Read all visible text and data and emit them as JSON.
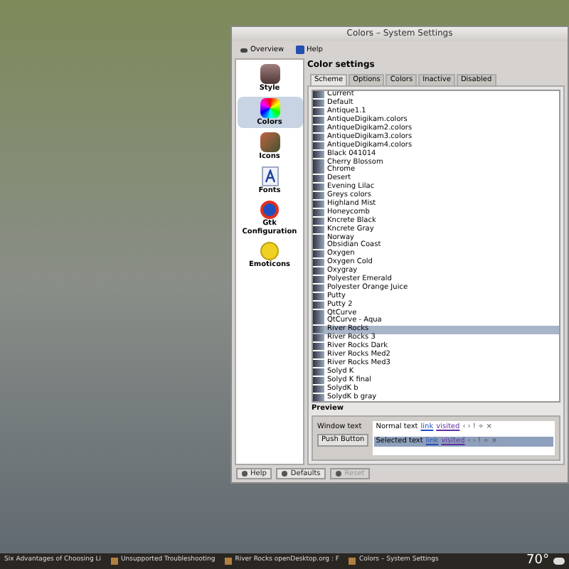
{
  "window": {
    "title": "Colors – System Settings"
  },
  "toolbar": [
    {
      "label": "Overview"
    },
    {
      "label": "Help"
    }
  ],
  "sidebar": {
    "items": [
      {
        "label": "Style",
        "selected": false,
        "kind": "style"
      },
      {
        "label": "Colors",
        "selected": true,
        "kind": "colors"
      },
      {
        "label": "Icons",
        "selected": false,
        "kind": "icons"
      },
      {
        "label": "Fonts",
        "selected": false,
        "kind": "fonts"
      },
      {
        "label": "Gtk Configuration",
        "selected": false,
        "kind": "gtk"
      },
      {
        "label": "Emoticons",
        "selected": false,
        "kind": "emoticons"
      }
    ]
  },
  "heading": "Color settings",
  "tabs": [
    {
      "label": "Scheme",
      "selected": true
    },
    {
      "label": "Options",
      "selected": false
    },
    {
      "label": "Colors",
      "selected": false
    },
    {
      "label": "Inactive",
      "selected": false
    },
    {
      "label": "Disabled",
      "selected": false
    }
  ],
  "schemes": [
    {
      "name": "Current",
      "selected": false
    },
    {
      "name": "Default",
      "selected": false
    },
    {
      "name": "Antique1.1",
      "selected": false
    },
    {
      "name": "AntiqueDigikam.colors",
      "selected": false
    },
    {
      "name": "AntiqueDigikam2.colors",
      "selected": false
    },
    {
      "name": "AntiqueDigikam3.colors",
      "selected": false
    },
    {
      "name": "AntiqueDigikam4.colors",
      "selected": false
    },
    {
      "name": "Black 041014",
      "selected": false
    },
    {
      "name": "Cherry Blossom",
      "selected": false
    },
    {
      "name": "Chrome",
      "selected": false
    },
    {
      "name": "Desert",
      "selected": false
    },
    {
      "name": "Evening Lilac",
      "selected": false
    },
    {
      "name": "Greys colors",
      "selected": false
    },
    {
      "name": "Highland Mist",
      "selected": false
    },
    {
      "name": "Honeycomb",
      "selected": false
    },
    {
      "name": "Kncrete Black",
      "selected": false
    },
    {
      "name": "Kncrete Gray",
      "selected": false
    },
    {
      "name": "Norway",
      "selected": false
    },
    {
      "name": "Obsidian Coast",
      "selected": false
    },
    {
      "name": "Oxygen",
      "selected": false
    },
    {
      "name": "Oxygen Cold",
      "selected": false
    },
    {
      "name": "Oxygray",
      "selected": false
    },
    {
      "name": "Polyester Emerald",
      "selected": false
    },
    {
      "name": "Polyester Orange Juice",
      "selected": false
    },
    {
      "name": "Putty",
      "selected": false
    },
    {
      "name": "Putty 2",
      "selected": false
    },
    {
      "name": "QtCurve",
      "selected": false
    },
    {
      "name": "QtCurve - Aqua",
      "selected": false
    },
    {
      "name": "River Rocks",
      "selected": true
    },
    {
      "name": "River Rocks 3",
      "selected": false
    },
    {
      "name": "River Rocks Dark",
      "selected": false
    },
    {
      "name": "River Rocks Med2",
      "selected": false
    },
    {
      "name": "River Rocks Med3",
      "selected": false
    },
    {
      "name": "Solyd K",
      "selected": false
    },
    {
      "name": "Solyd K final",
      "selected": false
    },
    {
      "name": "SolydK b",
      "selected": false
    },
    {
      "name": "SolydK b gray",
      "selected": false
    }
  ],
  "preview": {
    "title": "Preview",
    "window_text": "Window text",
    "push_button": "Push Button",
    "normal": {
      "label": "Normal text",
      "link": "link",
      "visited": "visited",
      "symbols": "‹ › ! ÷ ×"
    },
    "selected": {
      "label": "Selected text",
      "link": "link",
      "visited": "visited",
      "symbols": "‹ › ! ÷ ×"
    }
  },
  "buttons": [
    {
      "label": "Help",
      "disabled": false
    },
    {
      "label": "Defaults",
      "disabled": false
    },
    {
      "label": "Reset",
      "disabled": true
    }
  ],
  "taskbar": {
    "tasks": [
      "Six Advantages of Choosing Li",
      "Unsupported Troubleshooting",
      "River Rocks openDesktop.org : F",
      "Colors – System Settings"
    ],
    "temperature": "70°"
  }
}
